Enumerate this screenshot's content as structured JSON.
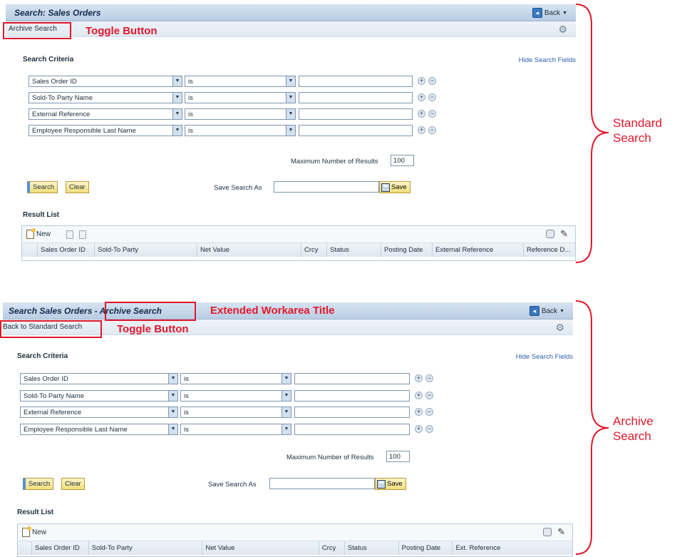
{
  "panels": {
    "standard": {
      "title": "Search: Sales Orders",
      "back_label": "Back",
      "toggle_label": "Archive Search",
      "search_criteria_title": "Search Criteria",
      "hide_search_fields": "Hide Search Fields",
      "criteria": [
        {
          "field": "Sales Order ID",
          "operator": "is",
          "value": ""
        },
        {
          "field": "Sold-To Party Name",
          "operator": "is",
          "value": ""
        },
        {
          "field": "External Reference",
          "operator": "is",
          "value": ""
        },
        {
          "field": "Employee Responsible Last Name",
          "operator": "is",
          "value": ""
        }
      ],
      "max_results_label": "Maximum Number of Results",
      "max_results_value": "100",
      "search_button": "Search",
      "clear_button": "Clear",
      "save_search_label": "Save Search As",
      "save_button": "Save",
      "result_list_title": "Result List",
      "new_button": "New",
      "columns": [
        "Sales Order ID",
        "Sold-To Party",
        "Net Value",
        "Crcy",
        "Status",
        "Posting Date",
        "External Reference",
        "Reference D..."
      ]
    },
    "archive": {
      "title_main": "Search Sales Orders",
      "title_extension": "- Archive Search",
      "back_label": "Back",
      "toggle_label": "Back to Standard Search",
      "search_criteria_title": "Search Criteria",
      "hide_search_fields": "Hide Search Fields",
      "criteria": [
        {
          "field": "Sales Order ID",
          "operator": "is",
          "value": ""
        },
        {
          "field": "Sold-To Party Name",
          "operator": "is",
          "value": ""
        },
        {
          "field": "External Reference",
          "operator": "is",
          "value": ""
        },
        {
          "field": "Employee Responsible Last Name",
          "operator": "is",
          "value": ""
        }
      ],
      "max_results_label": "Maximum Number of Results",
      "max_results_value": "100",
      "search_button": "Search",
      "clear_button": "Clear",
      "save_search_label": "Save Search As",
      "save_button": "Save",
      "result_list_title": "Result List",
      "new_button": "New",
      "columns": [
        "Sales Order ID",
        "Sold-To Party",
        "Net Value",
        "Crcy",
        "Status",
        "Posting Date",
        "Ext. Reference"
      ]
    }
  },
  "annotations": {
    "toggle_button": "Toggle Button",
    "extended_title": "Extended Workarea Title",
    "standard_search_line1": "Standard",
    "standard_search_line2": "Search",
    "archive_search_line1": "Archive",
    "archive_search_line2": "Search"
  },
  "colors": {
    "annotation_red": "#e0192a",
    "title_bar": "#c6d7ea",
    "button_yellow": "#f2dd7b",
    "link_blue": "#2d62a6"
  },
  "icons": [
    "back-icon",
    "gear-icon",
    "add-row-icon",
    "remove-row-icon",
    "dropdown-arrow-icon",
    "save-disk-icon",
    "new-document-icon",
    "delete-icon",
    "copy-icon",
    "print-icon",
    "pencil-icon"
  ]
}
